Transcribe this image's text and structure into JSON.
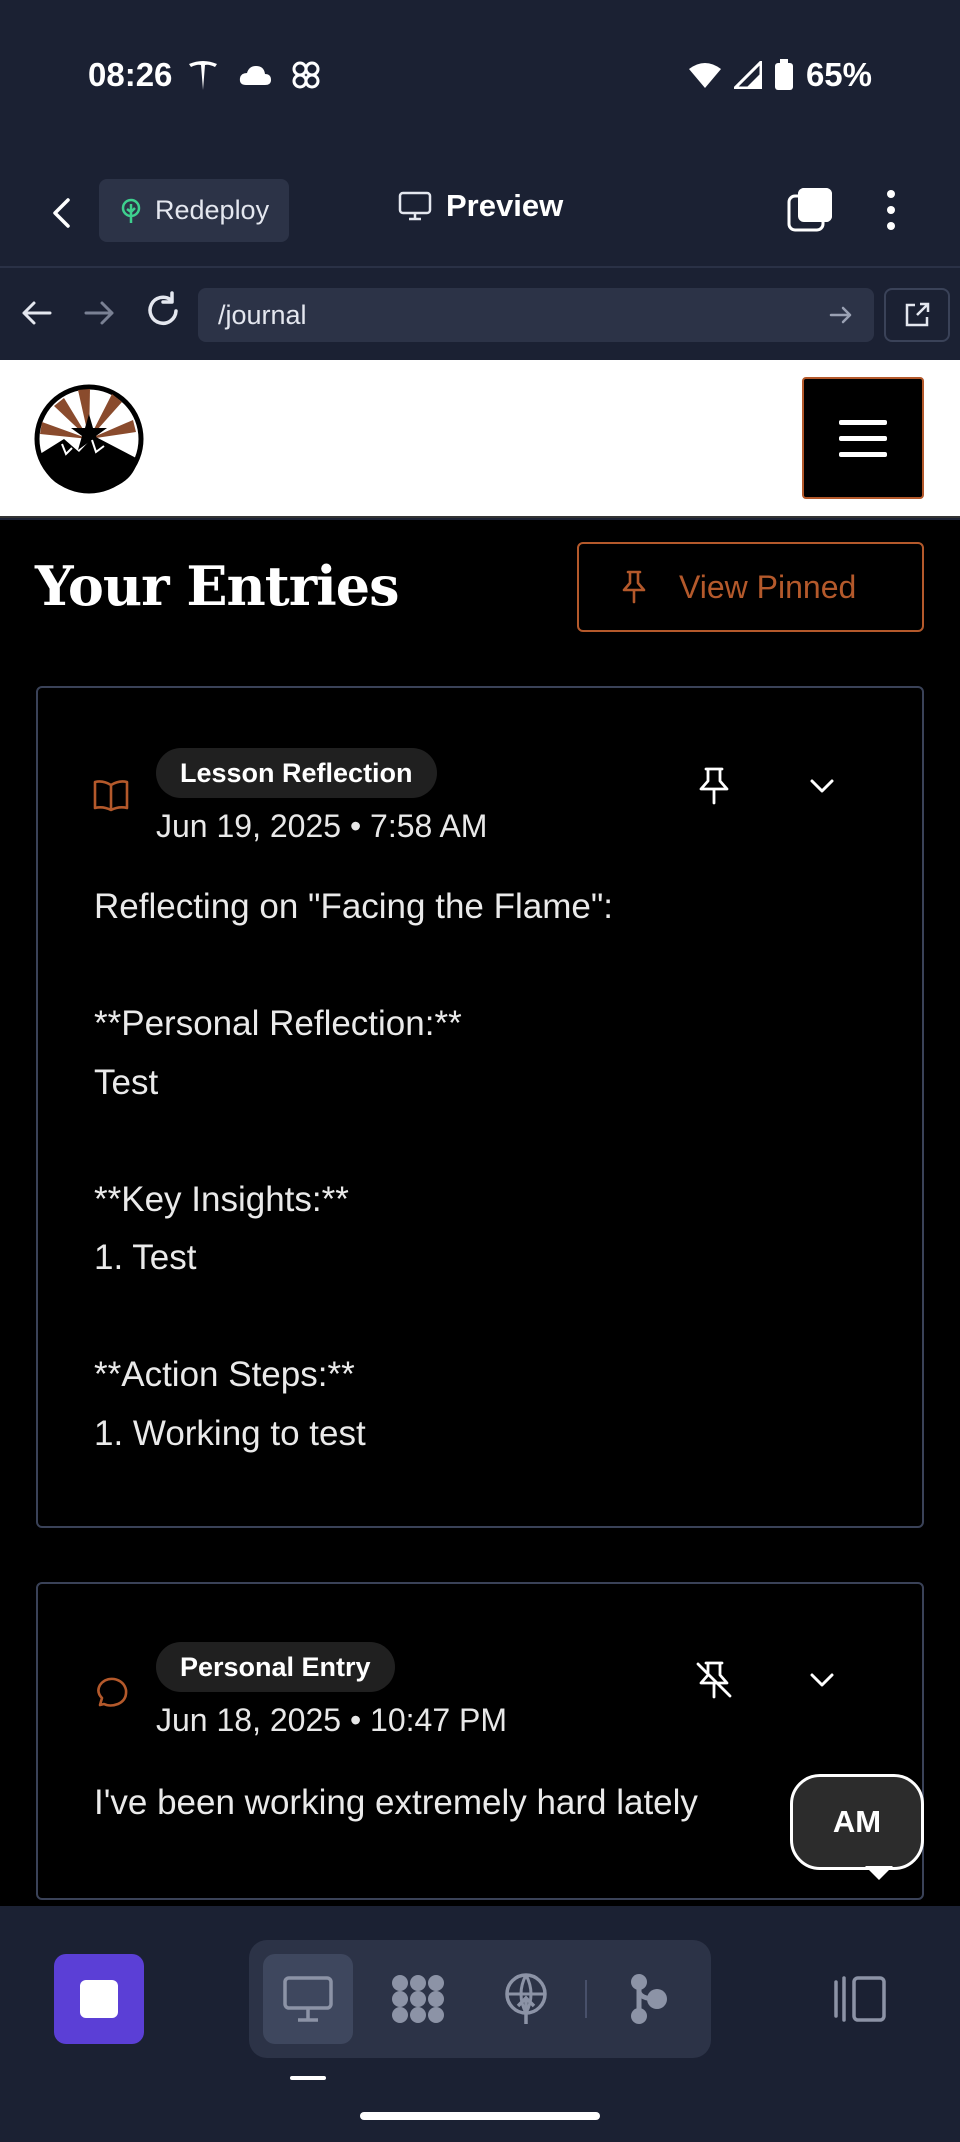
{
  "status_bar": {
    "time": "08:26",
    "battery": "65%"
  },
  "toolbar": {
    "redeploy_label": "Redeploy",
    "preview_label": "Preview"
  },
  "url_bar": {
    "path": "/journal"
  },
  "page": {
    "title": "Your Entries",
    "view_pinned_label": "View Pinned",
    "entries": [
      {
        "type": "Lesson Reflection",
        "date": "Jun 19, 2025 • 7:58 AM",
        "icon": "book-icon",
        "pinned": false,
        "body": "Reflecting on \"Facing the Flame\":\n\n**Personal Reflection:**\nTest\n\n**Key Insights:**\n1. Test\n\n**Action Steps:**\n1. Working to test"
      },
      {
        "type": "Personal Entry",
        "date": "Jun 18, 2025 • 10:47 PM",
        "icon": "chat-bubble-icon",
        "pinned": true,
        "body": "I've been working extremely hard lately"
      }
    ]
  },
  "assistant": {
    "initials": "AM"
  },
  "colors": {
    "accent": "#b4592b",
    "dock_primary": "#5b3fd6",
    "chrome_bg": "#1b2133"
  }
}
